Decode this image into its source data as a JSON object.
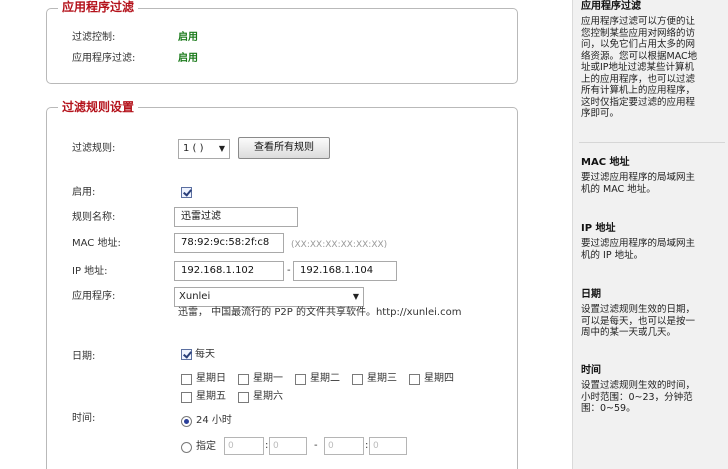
{
  "app_filter": {
    "legend": "应用程序过滤",
    "filter_control_label": "过滤控制:",
    "filter_control_value": "启用",
    "app_filter_label": "应用程序过滤:",
    "app_filter_value": "启用"
  },
  "rule_settings": {
    "legend": "过滤规则设置",
    "rules_label": "过滤规则:",
    "rules_select": "1 ( )",
    "view_all_button": "查看所有规则",
    "enable_label": "启用:",
    "enable_checked": true,
    "rule_name_label": "规则名称:",
    "rule_name_value": "迅雷过滤",
    "mac_label": "MAC 地址:",
    "mac_value": "78:92:9c:58:2f:c8",
    "mac_hint": "(XX:XX:XX:XX:XX:XX)",
    "ip_label": "IP 地址:",
    "ip_start": "192.168.1.102",
    "ip_dash": "-",
    "ip_end": "192.168.1.104",
    "app_label": "应用程序:",
    "app_select": "Xunlei",
    "app_desc": "迅雷， 中国最流行的 P2P 的文件共享软件。http://xunlei.com",
    "date_label": "日期:",
    "everyday_label": "每天",
    "weekdays": [
      "星期日",
      "星期一",
      "星期二",
      "星期三",
      "星期四",
      "星期五",
      "星期六"
    ],
    "time_label": "时间:",
    "time_24h_label": "24 小时",
    "time_custom_label": "指定",
    "time_fields": [
      "0",
      "0",
      "0",
      "0"
    ],
    "time_colon": ":",
    "time_dash": "-"
  },
  "sidebar": {
    "sections": [
      {
        "title": "应用程序过滤",
        "text": "应用程序过滤可以方便的让\n您控制某些应用对网络的访\n问，以免它们占用太多的网\n络资源。您可以根据MAC地\n址或IP地址过滤某些计算机\n上的应用程序，也可以过滤\n所有计算机上的应用程序，\n这时仅指定要过滤的应用程\n序即可。"
      },
      {
        "title": "MAC 地址",
        "text": "要过滤应用程序的局域网主\n机的 MAC 地址。"
      },
      {
        "title": "IP 地址",
        "text": "要过滤应用程序的局域网主\n机的 IP 地址。"
      },
      {
        "title": "日期",
        "text": "设置过滤规则生效的日期，\n可以是每天，也可以是按一\n周中的某一天或几天。"
      },
      {
        "title": "时间",
        "text": "设置过滤规则生效的时间，\n小时范围：0~23，分钟范\n围：0~59。"
      }
    ]
  }
}
